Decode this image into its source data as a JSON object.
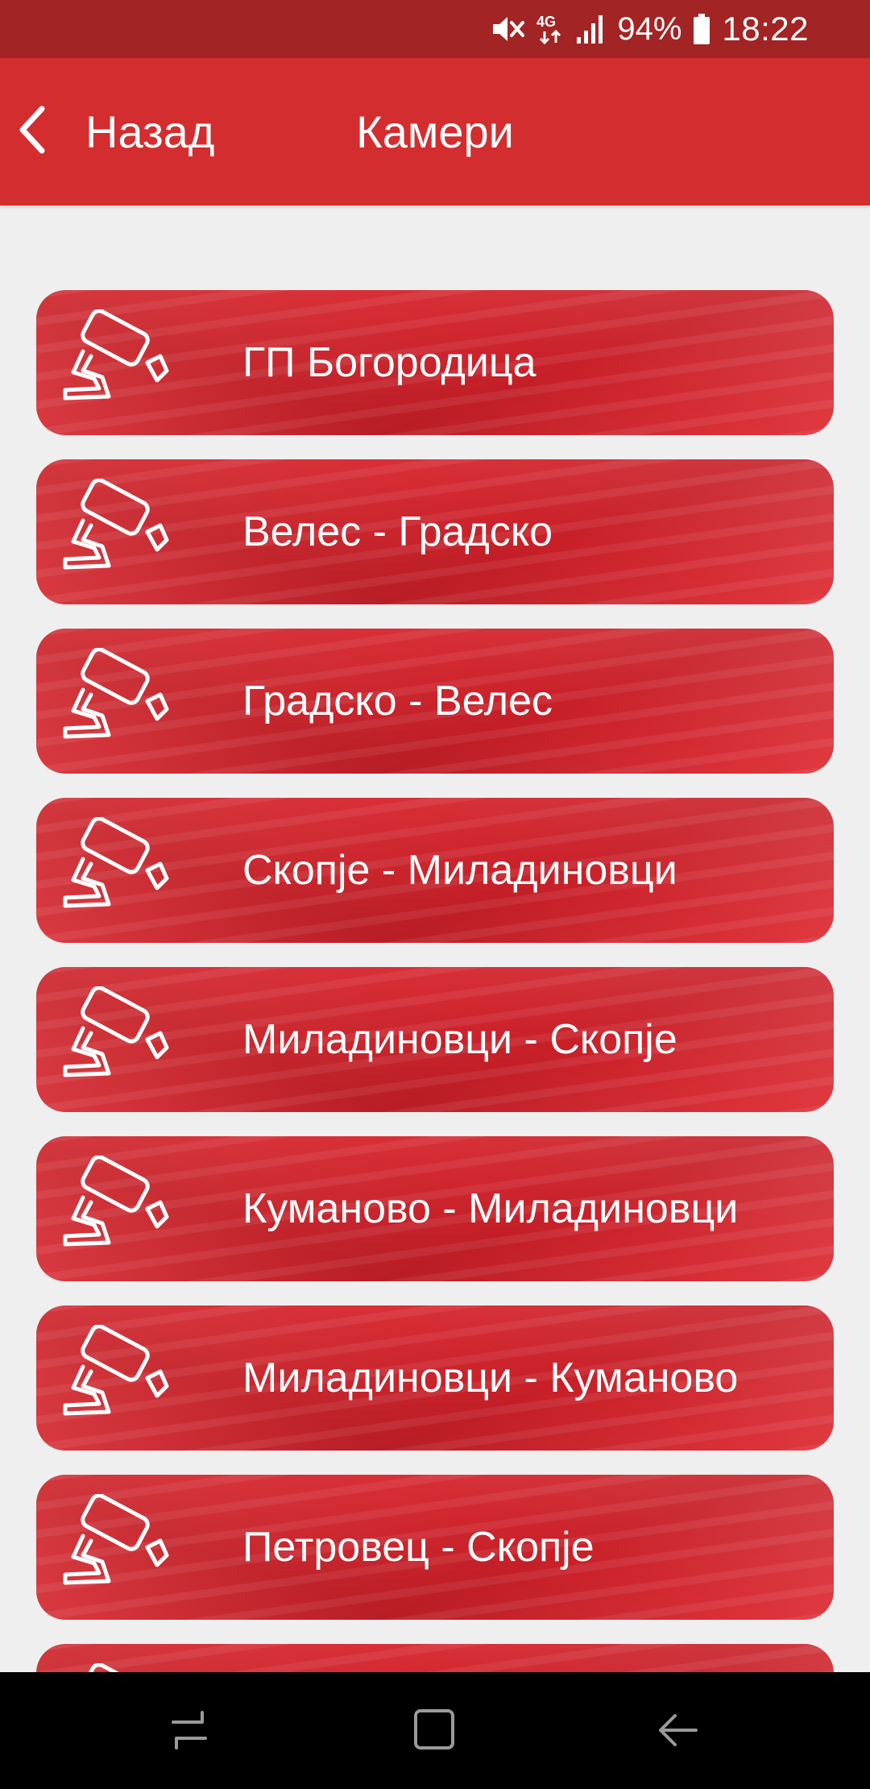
{
  "status_bar": {
    "battery": "94%",
    "time": "18:22",
    "network": "4G",
    "icons": [
      "mute-icon",
      "network-4g-icon",
      "signal-icon",
      "battery-icon"
    ]
  },
  "app_bar": {
    "back_label": "Назад",
    "title": "Камери"
  },
  "cameras": [
    {
      "label": "ГП Богородица"
    },
    {
      "label": "Велес - Градско"
    },
    {
      "label": "Градско - Велес"
    },
    {
      "label": "Скопје - Миладиновци"
    },
    {
      "label": "Миладиновци - Скопје"
    },
    {
      "label": "Куманово - Миладиновци"
    },
    {
      "label": "Миладиновци - Куманово"
    },
    {
      "label": "Петровец - Скопје"
    },
    {
      "label": ""
    }
  ],
  "nav_bar": {
    "buttons": [
      "recent-apps-icon",
      "home-icon",
      "back-nav-icon"
    ]
  },
  "colors": {
    "status_bar": "#a32424",
    "app_bar": "#d42d2f",
    "item": "#d52a32",
    "background": "#efefef",
    "nav_bar": "#000000"
  }
}
